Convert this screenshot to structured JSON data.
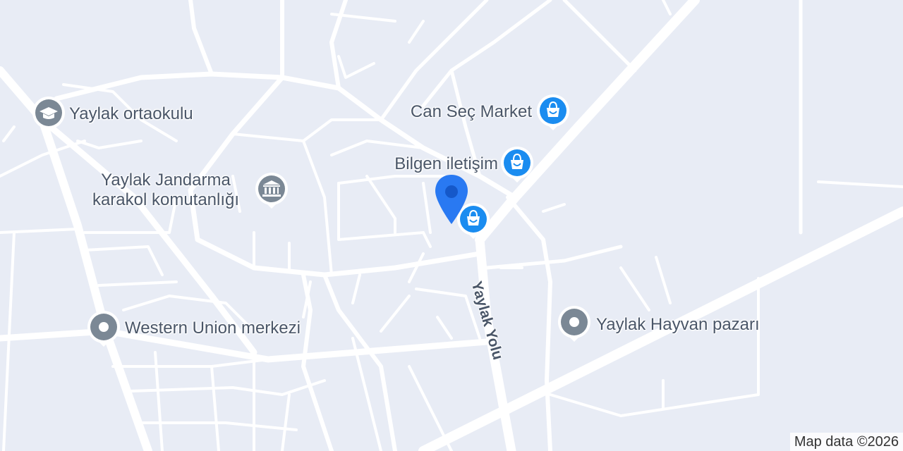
{
  "map": {
    "attribution": "Map data ©2026",
    "colors": {
      "background": "#e8ecf5",
      "road": "#ffffff",
      "shop_pin": "#1a8cf0",
      "generic_pin": "#7b8895",
      "selected_marker": "#2979f2"
    },
    "street": {
      "name": "Yaylak Yolu"
    },
    "pois": [
      {
        "id": "school",
        "label": "Yaylak ortaokulu",
        "icon": "school-icon",
        "category": "school"
      },
      {
        "id": "gendarmerie",
        "label_line1": "Yaylak Jandarma",
        "label_line2": "karakol komutanlığı",
        "icon": "government-building-icon",
        "category": "government"
      },
      {
        "id": "western-union",
        "label": "Western Union merkezi",
        "icon": "dot-icon",
        "category": "generic"
      },
      {
        "id": "can-sec-market",
        "label": "Can Seç Market",
        "icon": "shopping-bag-icon",
        "category": "shop"
      },
      {
        "id": "bilgen-iletisim",
        "label": "Bilgen iletişim",
        "icon": "shopping-bag-icon",
        "category": "shop"
      },
      {
        "id": "unnamed-shop",
        "label": "",
        "icon": "shopping-bag-icon",
        "category": "shop"
      },
      {
        "id": "hayvan-pazari",
        "label": "Yaylak Hayvan pazarı",
        "icon": "dot-icon",
        "category": "generic"
      }
    ],
    "selected_marker": {
      "icon": "location-pin-icon"
    }
  }
}
